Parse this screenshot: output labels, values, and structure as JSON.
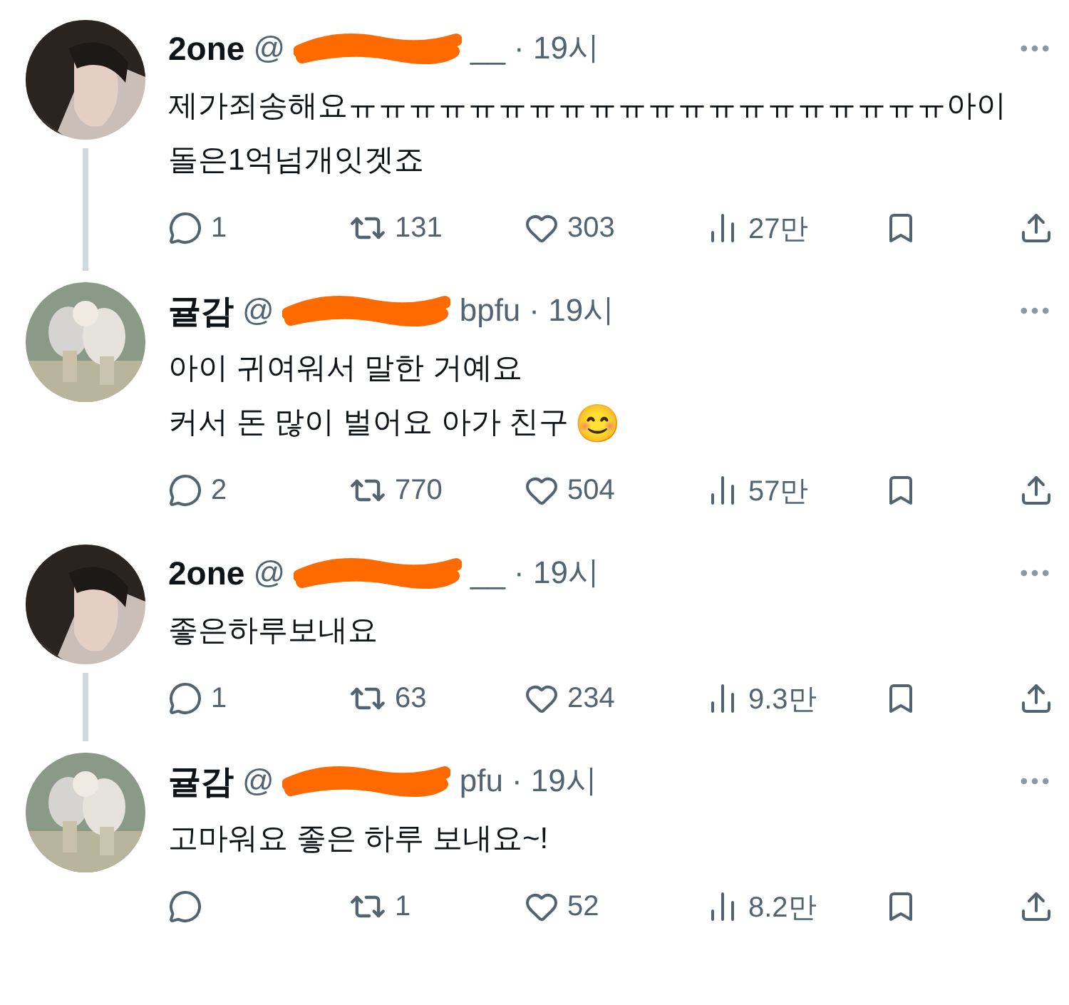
{
  "tweets": [
    {
      "name": "2one",
      "handle_start": "@",
      "handle_end": "__",
      "time": "· 19시",
      "thread_continues": true,
      "text": "제가죄송해요ㅠㅠㅠㅠㅠㅠㅠㅠㅠㅠㅠㅠㅠㅠㅠㅠㅠㅠㅠㅠ아이\n돌은1억넘개잇겟죠",
      "replies": "1",
      "reposts": "131",
      "likes": "303",
      "views": "27만"
    },
    {
      "name": "귤감",
      "handle_start": "@",
      "handle_end": "bpfu",
      "time": "· 19시",
      "thread_continues": false,
      "text": "아이 귀여워서 말한 거예요\n커서 돈 많이 벌어요 아가 친구",
      "emoji": "😊",
      "replies": "2",
      "reposts": "770",
      "likes": "504",
      "views": "57만"
    },
    {
      "name": "2one",
      "handle_start": "@",
      "handle_end": "__",
      "time": "· 19시",
      "thread_continues": true,
      "text": "좋은하루보내요",
      "replies": "1",
      "reposts": "63",
      "likes": "234",
      "views": "9.3만"
    },
    {
      "name": "귤감",
      "handle_start": "@",
      "handle_end": "pfu",
      "time": "· 19시",
      "thread_continues": false,
      "text": "고마워요 좋은 하루 보내요~!",
      "reposts": "1",
      "likes": "52",
      "views": "8.2만"
    }
  ]
}
